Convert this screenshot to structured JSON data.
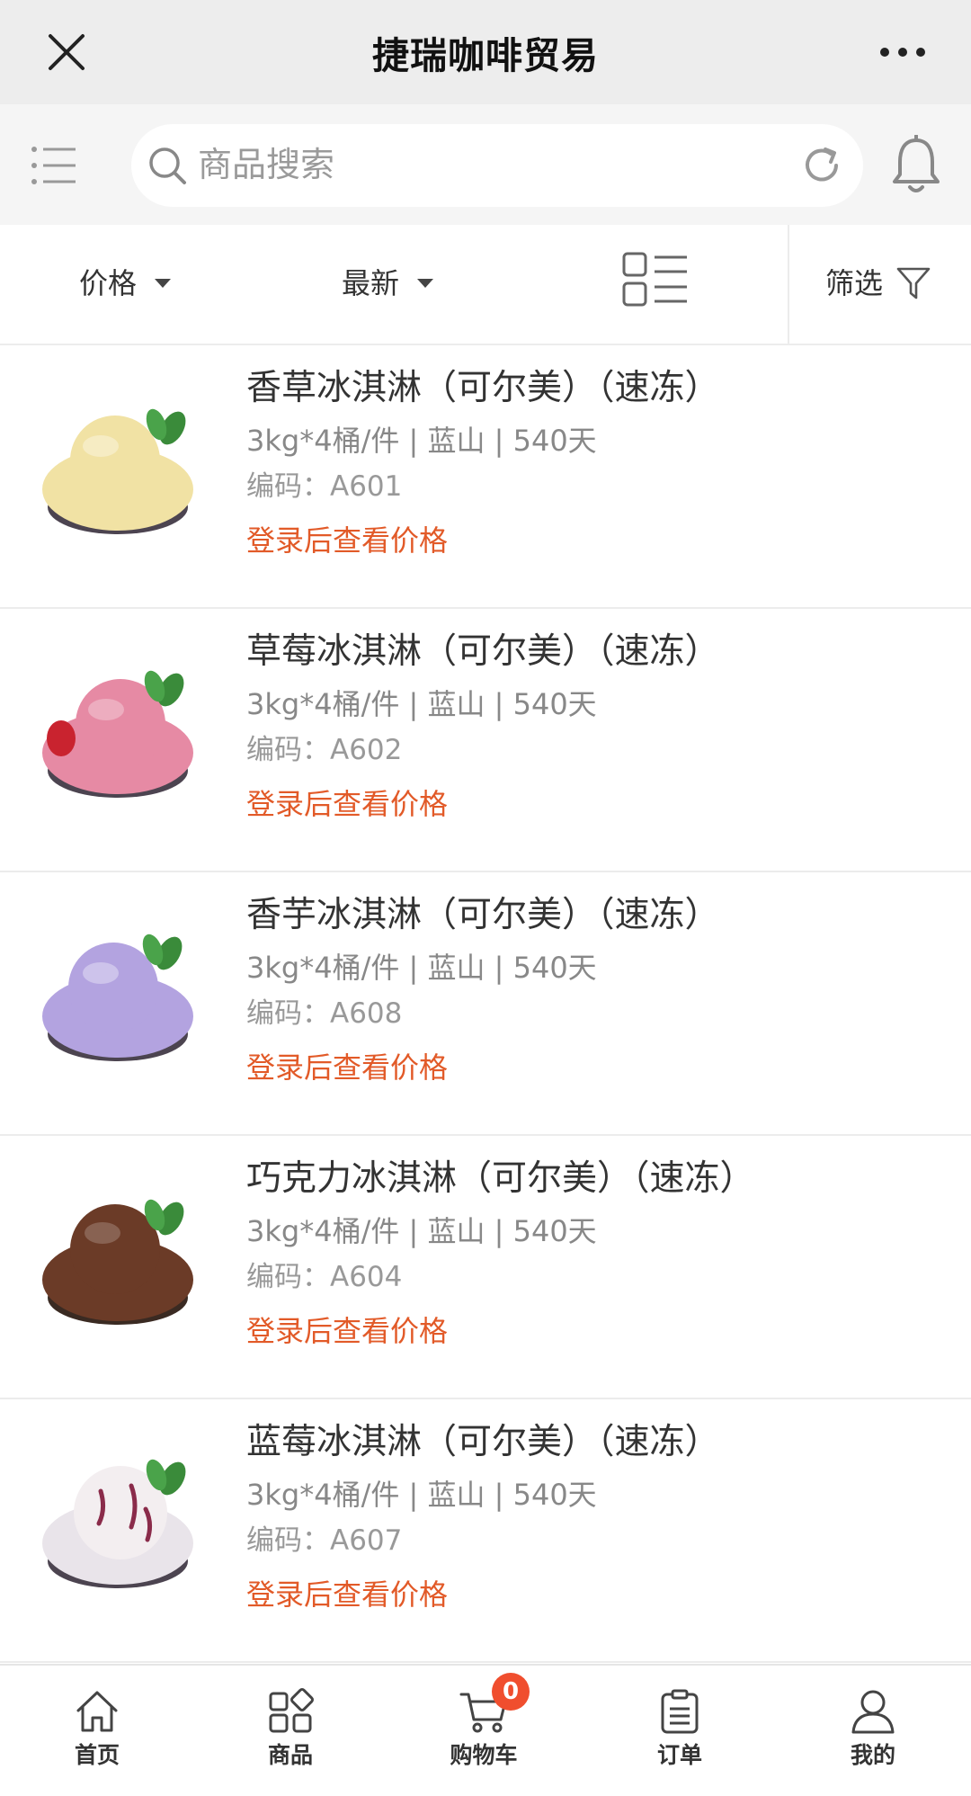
{
  "titlebar": {
    "title": "捷瑞咖啡贸易",
    "close_icon": "close-icon",
    "more_icon": "more-dots-icon"
  },
  "search": {
    "placeholder": "商品搜索",
    "menu_icon": "list-menu-icon",
    "search_icon": "search-icon",
    "refresh_icon": "refresh-icon",
    "bell_icon": "bell-icon"
  },
  "filters": {
    "price_label": "价格",
    "newest_label": "最新",
    "view_icon": "grid-list-view-icon",
    "filter_label": "筛选",
    "filter_icon": "funnel-icon"
  },
  "products": [
    {
      "name": "香草冰淇淋（可尔美）（速冻）",
      "spec": "3kg*4桶/件 | 蓝山 | 540天",
      "code": "编码：A601",
      "price_text": "登录后查看价格",
      "color": "#f1e2a4"
    },
    {
      "name": "草莓冰淇淋（可尔美）（速冻）",
      "spec": "3kg*4桶/件 | 蓝山 | 540天",
      "code": "编码：A602",
      "price_text": "登录后查看价格",
      "color": "#e68aa4"
    },
    {
      "name": "香芋冰淇淋（可尔美）（速冻）",
      "spec": "3kg*4桶/件 | 蓝山 | 540天",
      "code": "编码：A608",
      "price_text": "登录后查看价格",
      "color": "#b3a3e0"
    },
    {
      "name": "巧克力冰淇淋（可尔美）（速冻）",
      "spec": "3kg*4桶/件 | 蓝山 | 540天",
      "code": "编码：A604",
      "price_text": "登录后查看价格",
      "color": "#6b3b27"
    },
    {
      "name": "蓝莓冰淇淋（可尔美）（速冻）",
      "spec": "3kg*4桶/件 | 蓝山 | 540天",
      "code": "编码：A607",
      "price_text": "登录后查看价格",
      "color": "#f3eef0"
    }
  ],
  "tabbar": {
    "tabs": [
      {
        "label": "首页",
        "icon": "home-icon"
      },
      {
        "label": "商品",
        "icon": "category-icon"
      },
      {
        "label": "购物车",
        "icon": "cart-icon",
        "badge": "0"
      },
      {
        "label": "订单",
        "icon": "order-clipboard-icon"
      },
      {
        "label": "我的",
        "icon": "user-icon"
      }
    ]
  },
  "colors": {
    "accent": "#e25a28",
    "badge": "#f04e2e",
    "titlebar_bg": "#ededed",
    "search_bg": "#f5f5f5"
  }
}
